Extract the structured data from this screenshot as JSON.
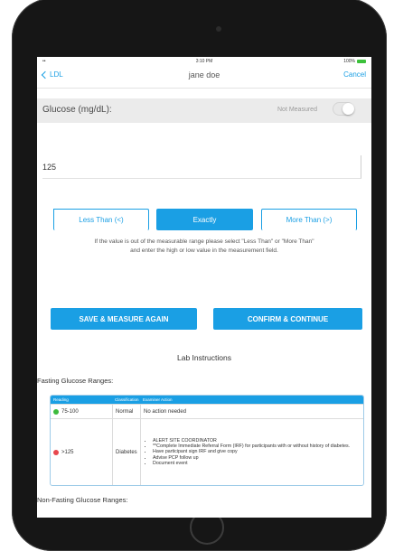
{
  "status_bar": {
    "time": "3:10 PM",
    "battery": "100%"
  },
  "nav": {
    "back_label": "LDL",
    "title": "jane doe",
    "cancel_label": "Cancel"
  },
  "measurement": {
    "label": "Glucose (mg/dL):",
    "not_measured_label": "Not Measured",
    "not_measured_on": false,
    "value": "125"
  },
  "segments": {
    "less": "Less Than (<)",
    "exact": "Exactly",
    "more": "More Than (>)",
    "selected": "exact"
  },
  "help_text": {
    "line1": "If the value is out of the measurable range please select \"Less Than\" or \"More Than\"",
    "line2": "and enter the high or low value in the measurement field."
  },
  "actions": {
    "save": "SAVE & MEASURE AGAIN",
    "confirm": "CONFIRM & CONTINUE"
  },
  "lab": {
    "title": "Lab Instructions",
    "fasting_title": "Fasting Glucose Ranges:",
    "nonfasting_title": "Non-Fasting Glucose Ranges:",
    "headers": [
      "Reading",
      "Classification",
      "Examiner Action"
    ],
    "rows": [
      {
        "dot_color": "#3dbb3d",
        "reading": "75-100",
        "classification": "Normal",
        "action": "No action needed"
      },
      {
        "dot_color": "#e8474e",
        "reading": ">125",
        "classification": "Diabetes",
        "bullets": [
          "ALERT SITE COORDINATOR",
          "**Complete Immediate Referral Form (IRF) for participants with or without history of diabetes.",
          "Have participant sign IRF and give copy",
          "Advise PCP follow up",
          "Document event"
        ]
      }
    ]
  }
}
